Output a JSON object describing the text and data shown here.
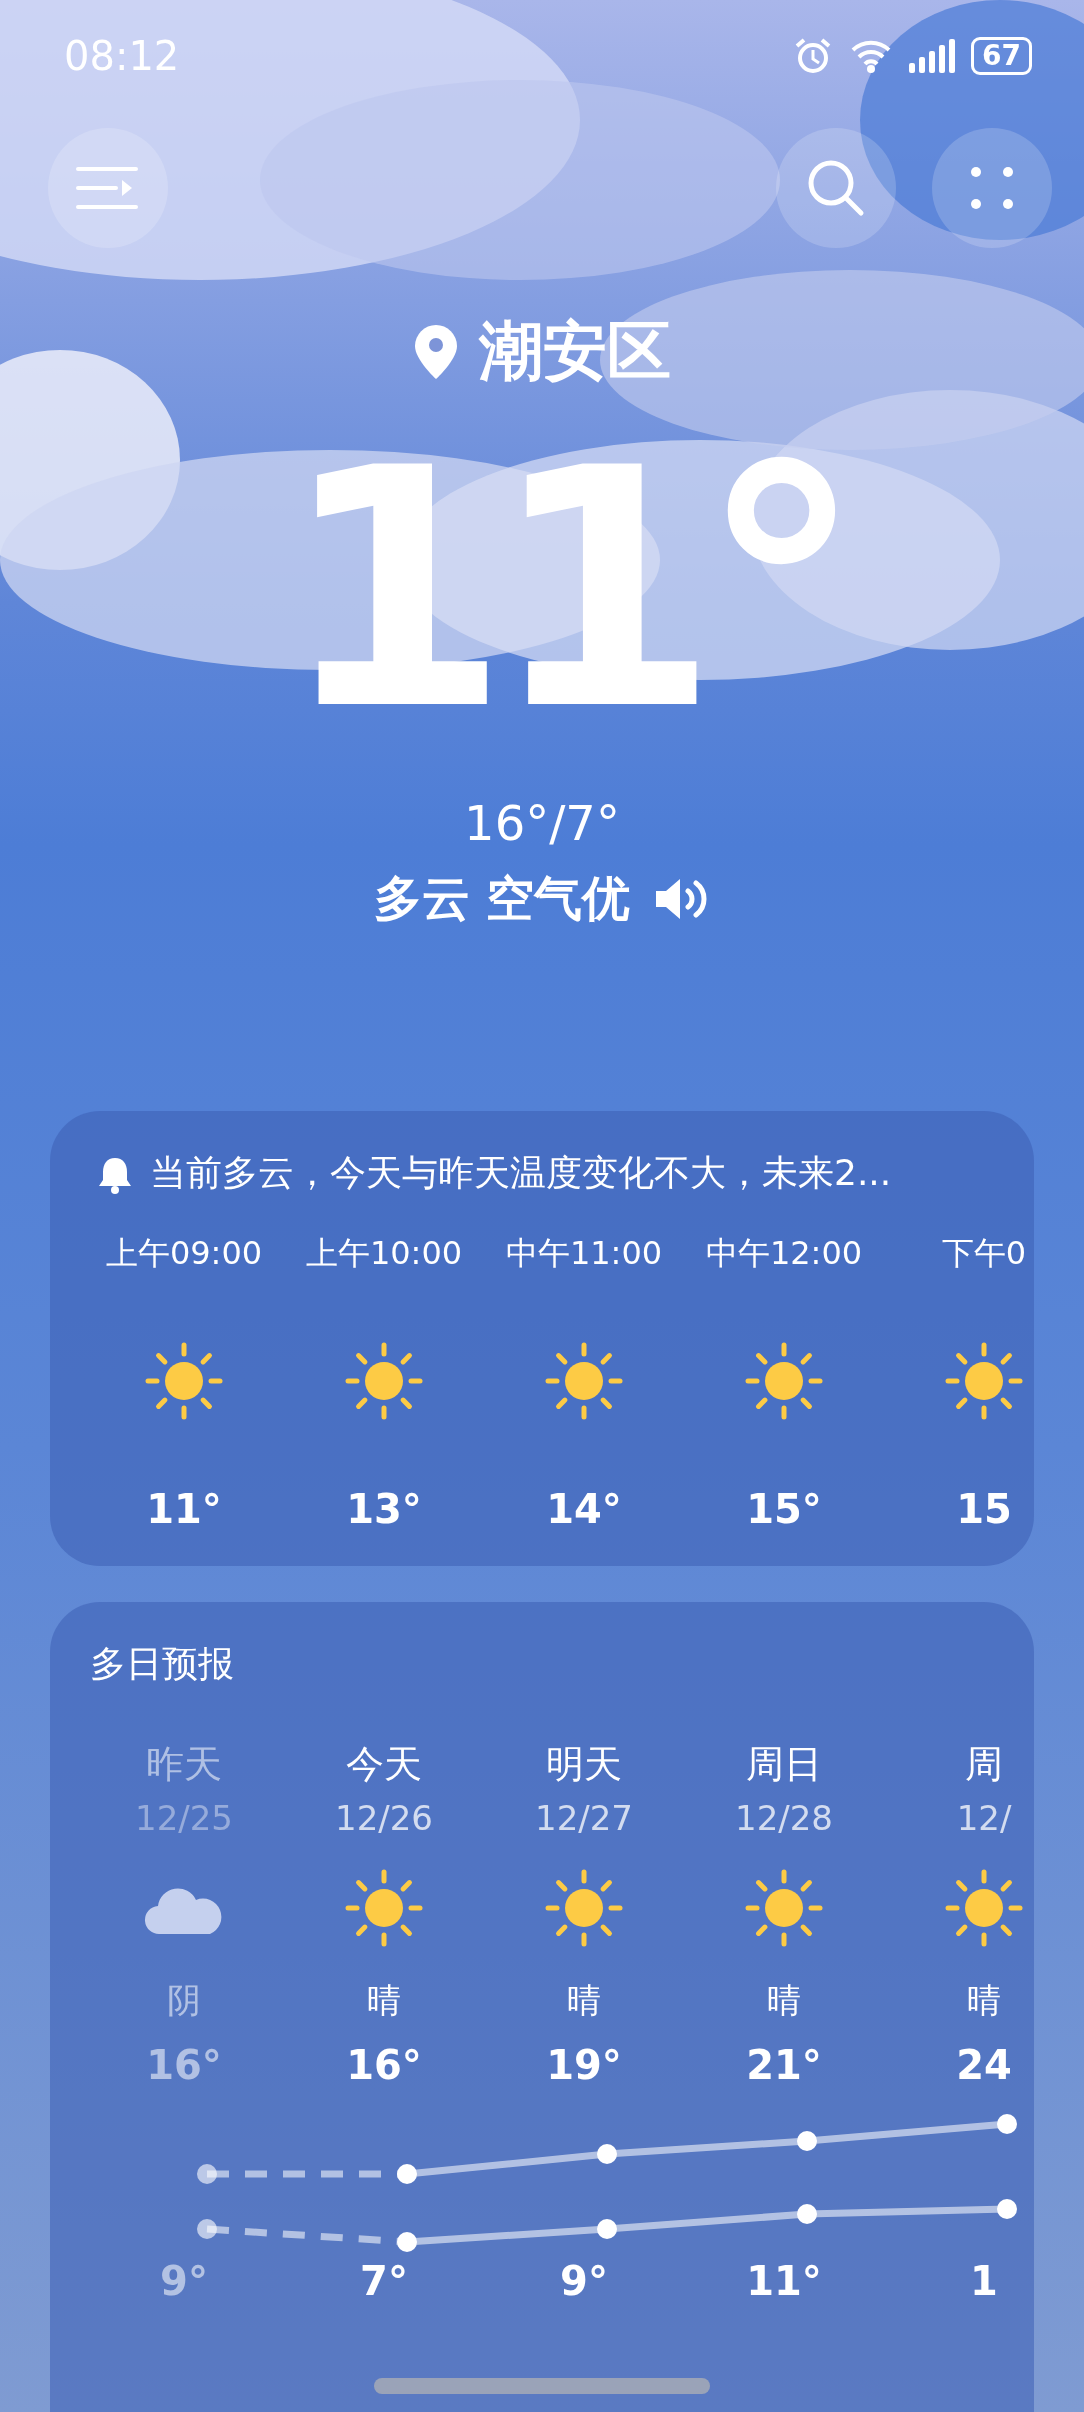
{
  "status_bar": {
    "time": "08:12",
    "battery": "67"
  },
  "location": "潮安区",
  "current": {
    "temperature": "11°",
    "range": "16°/7°",
    "condition": "多云 空气优"
  },
  "hourly": {
    "alert": "当前多云，今天与昨天温度变化不大，未来2...",
    "hours": [
      {
        "time": "上午09:00",
        "temp": "11°"
      },
      {
        "time": "上午10:00",
        "temp": "13°"
      },
      {
        "time": "中午11:00",
        "temp": "14°"
      },
      {
        "time": "中午12:00",
        "temp": "15°"
      },
      {
        "time": "下午0",
        "temp": "15"
      }
    ]
  },
  "daily": {
    "title": "多日预报",
    "days": [
      {
        "day": "昨天",
        "date": "12/25",
        "kind": "cloudy",
        "weather": "阴",
        "high": "16°",
        "low": "9°",
        "past": true
      },
      {
        "day": "今天",
        "date": "12/26",
        "kind": "sunny",
        "weather": "晴",
        "high": "16°",
        "low": "7°",
        "past": false
      },
      {
        "day": "明天",
        "date": "12/27",
        "kind": "sunny",
        "weather": "晴",
        "high": "19°",
        "low": "9°",
        "past": false
      },
      {
        "day": "周日",
        "date": "12/28",
        "kind": "sunny",
        "weather": "晴",
        "high": "21°",
        "low": "11°",
        "past": false
      },
      {
        "day": "周",
        "date": "12/",
        "kind": "sunny",
        "weather": "晴",
        "high": "24",
        "low": "1",
        "past": false
      }
    ]
  }
}
